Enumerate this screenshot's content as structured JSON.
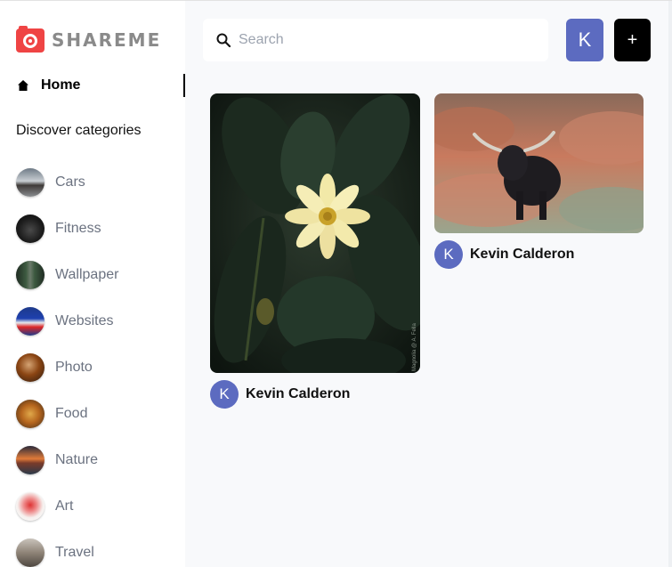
{
  "brand": {
    "logo_text": "SHAREME",
    "accent": "#ef4444"
  },
  "sidebar": {
    "home_label": "Home",
    "section_title": "Discover categories",
    "categories": [
      {
        "label": "Cars"
      },
      {
        "label": "Fitness"
      },
      {
        "label": "Wallpaper"
      },
      {
        "label": "Websites"
      },
      {
        "label": "Photo"
      },
      {
        "label": "Food"
      },
      {
        "label": "Nature"
      },
      {
        "label": "Art"
      },
      {
        "label": "Travel"
      }
    ]
  },
  "header": {
    "search_placeholder": "Search",
    "user_initial": "K",
    "add_label": "+"
  },
  "pins": [
    {
      "author_initial": "K",
      "author": "Kevin Calderon",
      "watermark": "Magnolia @ A. Fella",
      "subject": "flower"
    },
    {
      "author_initial": "K",
      "author": "Kevin Calderon",
      "subject": "highland-cow"
    }
  ],
  "colors": {
    "avatar": "#5c6bc0",
    "add_button": "#000000",
    "sidebar_bg": "#ffffff",
    "main_bg": "#f8f9fb"
  }
}
